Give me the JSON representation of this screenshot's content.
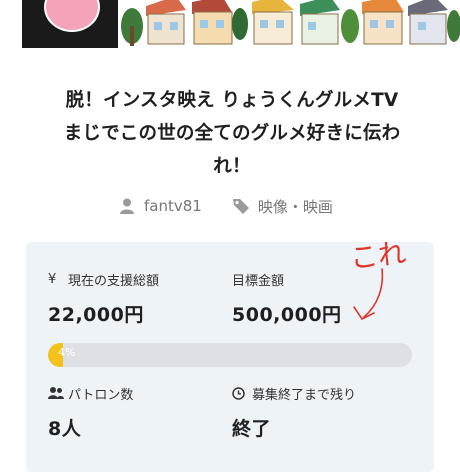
{
  "title_lines": [
    "脱！インスタ映え りょうくんグルメTV",
    "まじでこの世の全てのグルメ好きに伝わ",
    "れ！"
  ],
  "meta": {
    "owner": "fantv81",
    "category": "映像・映画",
    "owner_icon": "user-icon",
    "category_icon": "tag-icon"
  },
  "stats": {
    "raised_label": "現在の支援総額",
    "raised_value": "22,000円",
    "goal_label": "目標金額",
    "goal_value": "500,000円",
    "progress_text": "4%",
    "progress_fraction": 0.04,
    "patrons_label": "パトロン数",
    "patrons_value": "8人",
    "remaining_label": "募集終了まで残り",
    "remaining_value": "終了"
  },
  "annotation": {
    "text": "これ",
    "color": "#e0372c"
  },
  "colors": {
    "progress_fill": "#f3c31b",
    "card_bg": "#eef3f8",
    "progress_track": "#dde1e6"
  }
}
